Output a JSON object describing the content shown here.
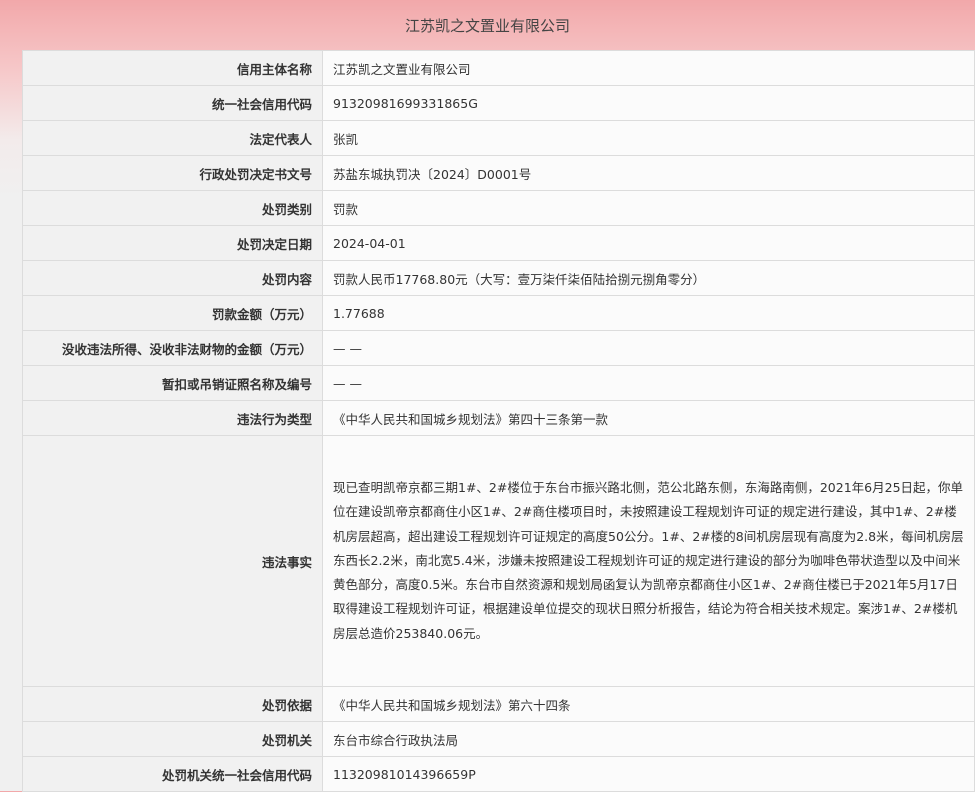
{
  "title": "江苏凯之文置业有限公司",
  "rows": [
    {
      "label": "信用主体名称",
      "value": "江苏凯之文置业有限公司"
    },
    {
      "label": "统一社会信用代码",
      "value": "91320981699331865G"
    },
    {
      "label": "法定代表人",
      "value": "张凯"
    },
    {
      "label": "行政处罚决定书文号",
      "value": "苏盐东城执罚决〔2024〕D0001号"
    },
    {
      "label": "处罚类别",
      "value": "罚款"
    },
    {
      "label": "处罚决定日期",
      "value": "2024-04-01"
    },
    {
      "label": "处罚内容",
      "value": "罚款人民币17768.80元（大写：壹万柒仟柒佰陆拾捌元捌角零分）"
    },
    {
      "label": "罚款金额（万元）",
      "value": "1.77688"
    },
    {
      "label": "没收违法所得、没收非法财物的金额（万元）",
      "value": "— —"
    },
    {
      "label": "暂扣或吊销证照名称及编号",
      "value": "— —"
    },
    {
      "label": "违法行为类型",
      "value": "《中华人民共和国城乡规划法》第四十三条第一款"
    },
    {
      "label": "违法事实",
      "value": "现已查明凯帝京都三期1#、2#楼位于东台市振兴路北侧，范公北路东侧，东海路南侧，2021年6月25日起，你单位在建设凯帝京都商住小区1#、2#商住楼项目时，未按照建设工程规划许可证的规定进行建设，其中1#、2#楼机房层超高，超出建设工程规划许可证规定的高度50公分。1#、2#楼的8间机房层现有高度为2.8米，每间机房层东西长2.2米，南北宽5.4米，涉嫌未按照建设工程规划许可证的规定进行建设的部分为咖啡色带状造型以及中间米黄色部分，高度0.5米。东台市自然资源和规划局函复认为凯帝京都商住小区1#、2#商住楼已于2021年5月17日取得建设工程规划许可证，根据建设单位提交的现状日照分析报告，结论为符合相关技术规定。案涉1#、2#楼机房层总造价253840.06元。"
    },
    {
      "label": "处罚依据",
      "value": "《中华人民共和国城乡规划法》第六十四条"
    },
    {
      "label": "处罚机关",
      "value": "东台市综合行政执法局"
    },
    {
      "label": "处罚机关统一社会信用代码",
      "value": "11320981014396659P"
    }
  ]
}
